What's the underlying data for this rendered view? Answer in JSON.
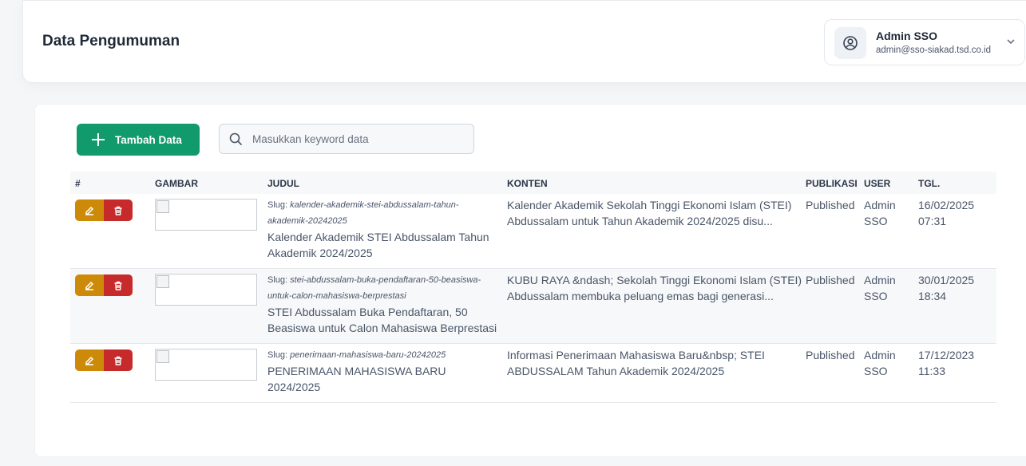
{
  "header": {
    "title": "Data Pengumuman",
    "user": {
      "name": "Admin SSO",
      "email": "admin@sso-siakad.tsd.co.id"
    }
  },
  "toolbar": {
    "add_label": "Tambah Data",
    "search_placeholder": "Masukkan keyword data"
  },
  "table": {
    "columns": [
      "#",
      "GAMBAR",
      "JUDUL",
      "KONTEN",
      "PUBLIKASI",
      "USER",
      "TGL."
    ],
    "slug_prefix": "Slug:",
    "rows": [
      {
        "slug_l1": "kalender-akademik-stei-abdussalam-tahun-",
        "slug_l2": "akademik-20242025",
        "title_l1": "Kalender Akademik STEI Abdussalam Tahun",
        "title_l2": "Akademik 2024/2025",
        "content_l1": "Kalender Akademik Sekolah Tinggi Ekonomi Islam (STEI)",
        "content_l2": "Abdussalam untuk Tahun Akademik 2024/2025 disu...",
        "status": "Published",
        "user_l1": "Admin",
        "user_l2": "SSO",
        "date": "16/02/2025",
        "time": "07:31"
      },
      {
        "slug_l1": "stei-abdussalam-buka-pendaftaran-50-beasiswa-",
        "slug_l2": "untuk-calon-mahasiswa-berprestasi",
        "title_l1": "STEI Abdussalam Buka Pendaftaran, 50",
        "title_l2": "Beasiswa untuk Calon Mahasiswa Berprestasi",
        "content_l1": "KUBU RAYA &ndash; Sekolah Tinggi Ekonomi Islam (STEI)",
        "content_l2": "Abdussalam membuka peluang emas bagi generasi...",
        "status": "Published",
        "user_l1": "Admin",
        "user_l2": "SSO",
        "date": "30/01/2025",
        "time": "18:34"
      },
      {
        "slug_l1": "penerimaan-mahasiswa-baru-20242025",
        "slug_l2": "",
        "title_l1": "PENERIMAAN MAHASISWA BARU",
        "title_l2": "2024/2025",
        "content_l1": "Informasi Penerimaan Mahasiswa Baru&nbsp; STEI",
        "content_l2": "ABDUSSALAM Tahun Akademik 2024/2025",
        "status": "Published",
        "user_l1": "Admin",
        "user_l2": "SSO",
        "date": "17/12/2023",
        "time": "11:33"
      }
    ]
  },
  "colors": {
    "primary": "#119a6b",
    "edit": "#cc8a08",
    "delete": "#c62a2a"
  }
}
